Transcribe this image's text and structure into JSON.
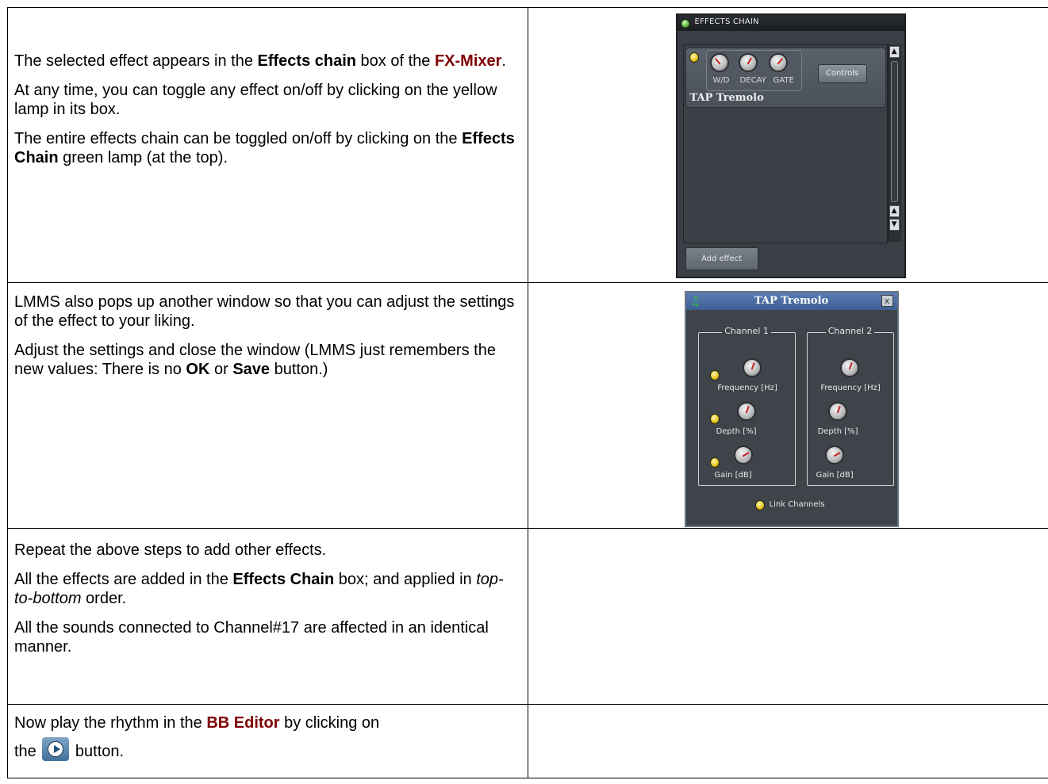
{
  "rows": [
    {
      "paragraphs": [
        [
          "The selected effect appears in the ",
          "Effects chain",
          " box of the ",
          "FX-Mixer",
          "."
        ],
        "At any time, you can toggle any effect on/off by clicking on the yellow lamp in its box.",
        [
          "The entire effects chain can be toggled on/off by clicking on the ",
          "Effects Chain",
          " green lamp (at the top)."
        ]
      ]
    },
    {
      "paragraphs": [
        "LMMS also pops up another window so that you can adjust the settings of the effect to your liking.",
        [
          "Adjust the settings and close the window (LMMS just remembers the new values: There is no ",
          "OK",
          " or ",
          "Save",
          " button.)"
        ]
      ]
    },
    {
      "paragraphs": [
        "Repeat the above steps to add other effects.",
        [
          "All the effects are added in the ",
          "Effects Chain",
          " box; and applied in ",
          "top-to-bottom",
          " order."
        ],
        "All the sounds connected to Channel#17 are affected in an identical manner."
      ]
    },
    {
      "paragraphs": [
        [
          "Now play the rhythm in the ",
          "BB Editor",
          " by clicking on"
        ],
        [
          "the",
          " button."
        ]
      ]
    }
  ],
  "effects_chain": {
    "title": "EFFECTS CHAIN",
    "effect": {
      "name": "TAP Tremolo",
      "knobs": [
        "W/D",
        "DECAY",
        "GATE"
      ],
      "controls_label": "Controls"
    },
    "add_effect_label": "Add effect",
    "icons": {
      "enable_lamp": "green-lamp-icon",
      "effect_lamp": "yellow-lamp-icon"
    }
  },
  "tap_window": {
    "title": "TAP Tremolo",
    "close_label": "x",
    "channels": [
      {
        "title": "Channel 1",
        "knobs": [
          "Frequency [Hz]",
          "Depth [%]",
          "Gain [dB]"
        ]
      },
      {
        "title": "Channel 2",
        "knobs": [
          "Frequency [Hz]",
          "Depth [%]",
          "Gain [dB]"
        ]
      }
    ],
    "link_label": "Link Channels"
  },
  "colors": {
    "link_red": "#7f0000",
    "panel_bg": "#3a3f46",
    "title_blue": "#4a6ea8"
  }
}
